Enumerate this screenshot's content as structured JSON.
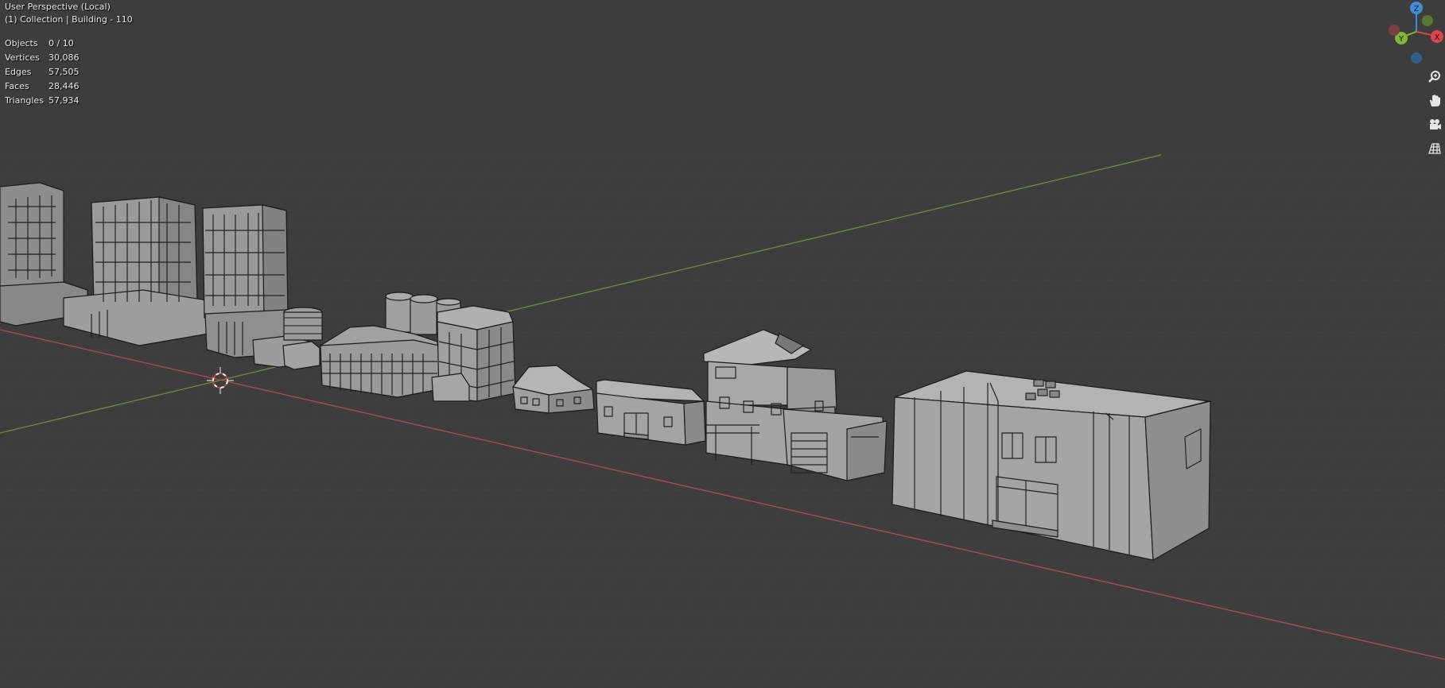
{
  "viewport": {
    "title": "User Perspective (Local)",
    "collection_line": "(1) Collection | Building - 110"
  },
  "stats": [
    {
      "label": "Objects",
      "value": "0 / 10"
    },
    {
      "label": "Vertices",
      "value": "30,086"
    },
    {
      "label": "Edges",
      "value": "57,505"
    },
    {
      "label": "Faces",
      "value": "28,446"
    },
    {
      "label": "Triangles",
      "value": "57,934"
    }
  ],
  "gizmo": {
    "z_label": "Z",
    "y_label": "Y",
    "x_label": "X",
    "colors": {
      "x": "#e0434e",
      "y": "#7cb833",
      "z": "#3d8fdb"
    }
  },
  "nav_controls": [
    {
      "name": "zoom-icon"
    },
    {
      "name": "hand-pan-icon"
    },
    {
      "name": "camera-view-icon"
    },
    {
      "name": "grid-ortho-icon"
    }
  ],
  "colors": {
    "background": "#3d3d3d",
    "grid": "#4a4a4a",
    "x_axis": "#b54a50",
    "y_axis": "#6f8f34",
    "building_fill": "#9a9a9a",
    "building_shade": "#7c7c7c",
    "building_edge": "#1b1b1b"
  }
}
